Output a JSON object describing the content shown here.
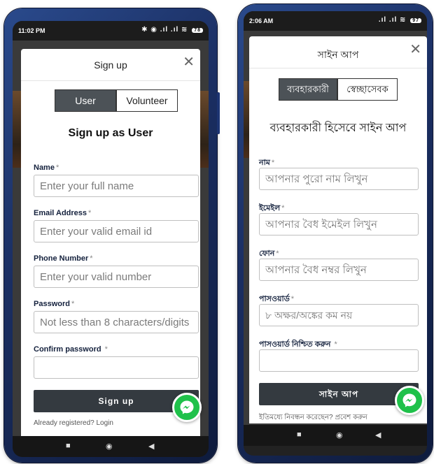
{
  "left": {
    "status": {
      "time": "11:02 PM",
      "icons": "✱ ◉ .ıl .ıl ≋",
      "battery": "78"
    },
    "modal_title": "Sign up",
    "close_glyph": "✕",
    "tabs": [
      "User",
      "Volunteer"
    ],
    "heading": "Sign up as User",
    "fields": [
      {
        "label": "Name",
        "placeholder": "Enter your full name"
      },
      {
        "label": "Email Address",
        "placeholder": "Enter your valid email id"
      },
      {
        "label": "Phone Number",
        "placeholder": "Enter your valid number"
      },
      {
        "label": "Password",
        "placeholder": "Not less than 8 characters/digits"
      },
      {
        "label": "Confirm password",
        "placeholder": ""
      }
    ],
    "required_mark": "*",
    "submit_label": "Sign up",
    "login_text": "Already registered? Login",
    "nav": {
      "recent": "■",
      "home": "◉",
      "back": "◀"
    }
  },
  "right": {
    "status": {
      "time": "2:06 AM",
      "icons": ".ıl .ıl ≋",
      "battery": "97"
    },
    "modal_title": "সাইন আপ",
    "close_glyph": "✕",
    "tabs": [
      "ব্যবহারকারী",
      "স্বেচ্ছাসেবক"
    ],
    "heading": "ব্যবহারকারী হিসেবে সাইন আপ",
    "fields": [
      {
        "label": "নাম",
        "placeholder": "আপনার পুরো নাম লিখুন"
      },
      {
        "label": "ইমেইল",
        "placeholder": "আপনার বৈধ ইমেইল লিখুন"
      },
      {
        "label": "ফোন",
        "placeholder": "আপনার বৈধ নম্বর লিখুন"
      },
      {
        "label": "পাসওয়ার্ড",
        "placeholder": "৮ অক্ষর/অঙ্কের কম নয়"
      },
      {
        "label": "পাসওয়ার্ড নিশ্চিত করুন",
        "placeholder": ""
      }
    ],
    "required_mark": "*",
    "submit_label": "সাইন আপ",
    "login_text": "ইতিমধ্যে নিবন্ধন করেছেন? প্রবেশ করুন",
    "nav": {
      "recent": "■",
      "home": "◉",
      "back": "◀"
    }
  },
  "colors": {
    "active_tab": "#4c5257",
    "submit": "#343a40",
    "messenger": "#1fc14a",
    "label": "#14213d",
    "phone_frame": "#1b2f63"
  }
}
